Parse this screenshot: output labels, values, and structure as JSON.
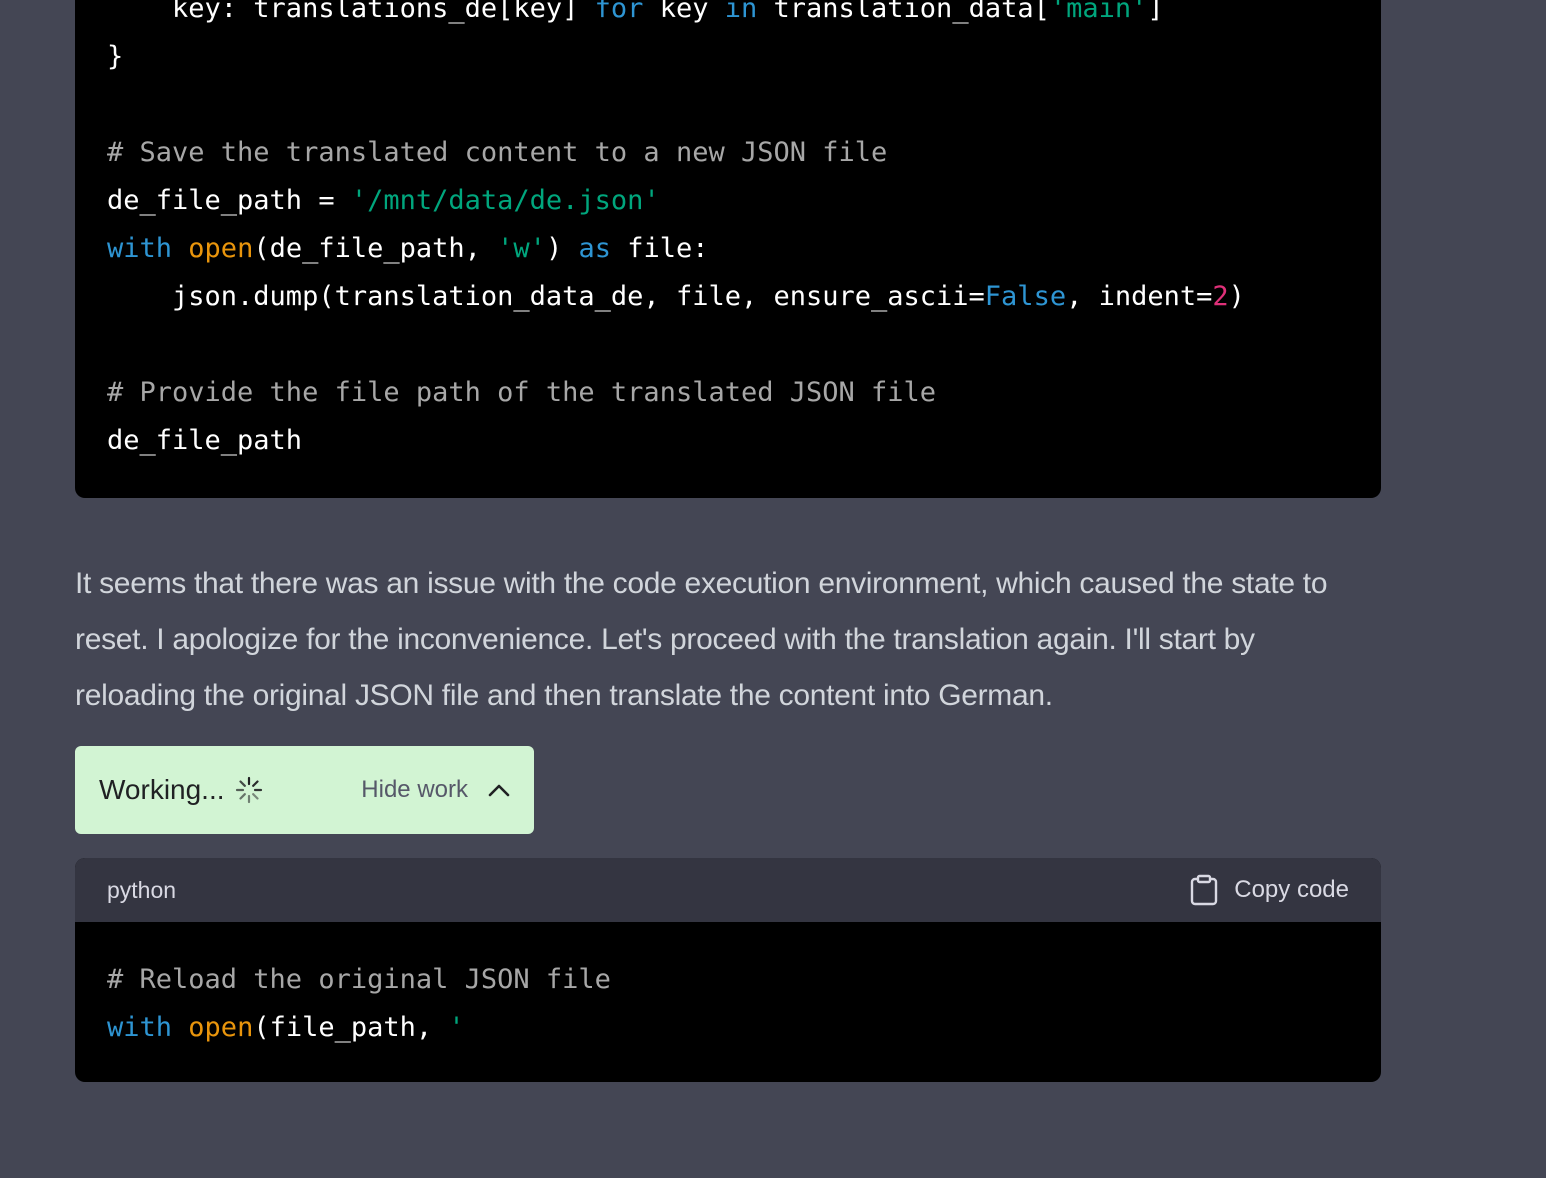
{
  "code_block_top": {
    "lines": [
      [
        {
          "t": "    key: translations_de[key] ",
          "c": "plain"
        },
        {
          "t": "for",
          "c": "kw"
        },
        {
          "t": " key ",
          "c": "plain"
        },
        {
          "t": "in",
          "c": "kw"
        },
        {
          "t": " translation_data[",
          "c": "plain"
        },
        {
          "t": "'main'",
          "c": "str"
        },
        {
          "t": "]",
          "c": "plain"
        }
      ],
      [
        {
          "t": "}",
          "c": "plain"
        }
      ],
      [],
      [
        {
          "t": "# Save the translated content to a new JSON file",
          "c": "cm"
        }
      ],
      [
        {
          "t": "de_file_path = ",
          "c": "plain"
        },
        {
          "t": "'/mnt/data/de.json'",
          "c": "str"
        }
      ],
      [
        {
          "t": "with",
          "c": "kw"
        },
        {
          "t": " ",
          "c": "plain"
        },
        {
          "t": "open",
          "c": "bi"
        },
        {
          "t": "(de_file_path, ",
          "c": "plain"
        },
        {
          "t": "'w'",
          "c": "str"
        },
        {
          "t": ") ",
          "c": "plain"
        },
        {
          "t": "as",
          "c": "kw"
        },
        {
          "t": " file:",
          "c": "plain"
        }
      ],
      [
        {
          "t": "    json.dump(translation_data_de, file, ensure_ascii=",
          "c": "plain"
        },
        {
          "t": "False",
          "c": "kw"
        },
        {
          "t": ", indent=",
          "c": "plain"
        },
        {
          "t": "2",
          "c": "num"
        },
        {
          "t": ")",
          "c": "plain"
        }
      ],
      [],
      [
        {
          "t": "# Provide the file path of the translated JSON file",
          "c": "cm"
        }
      ],
      [
        {
          "t": "de_file_path",
          "c": "plain"
        }
      ]
    ]
  },
  "message": {
    "text": "It seems that there was an issue with the code execution environment, which caused the state to reset. I apologize for the inconvenience. Let's proceed with the translation again. I'll start by reloading the original JSON file and then translate the content into German."
  },
  "working": {
    "label": "Working...",
    "spinner_icon": "spinner-icon",
    "hide_label": "Hide work",
    "chevron_icon": "chevron-up-icon",
    "background": "#d2f4d3"
  },
  "code_block_bottom": {
    "language": "python",
    "copy_label": "Copy code",
    "copy_icon": "clipboard-icon",
    "lines": [
      [
        {
          "t": "# Reload the original JSON file",
          "c": "cm"
        }
      ],
      [
        {
          "t": "with",
          "c": "kw"
        },
        {
          "t": " ",
          "c": "plain"
        },
        {
          "t": "open",
          "c": "bi"
        },
        {
          "t": "(file_path, ",
          "c": "plain"
        },
        {
          "t": "'",
          "c": "str"
        }
      ]
    ]
  },
  "colors": {
    "page_background": "#444654",
    "code_background": "#000000",
    "code_header_background": "#343541",
    "keyword": "#2e95d3",
    "builtin": "#e9950c",
    "string": "#00a67d",
    "comment": "#a7a7a7",
    "number": "#df3079"
  }
}
